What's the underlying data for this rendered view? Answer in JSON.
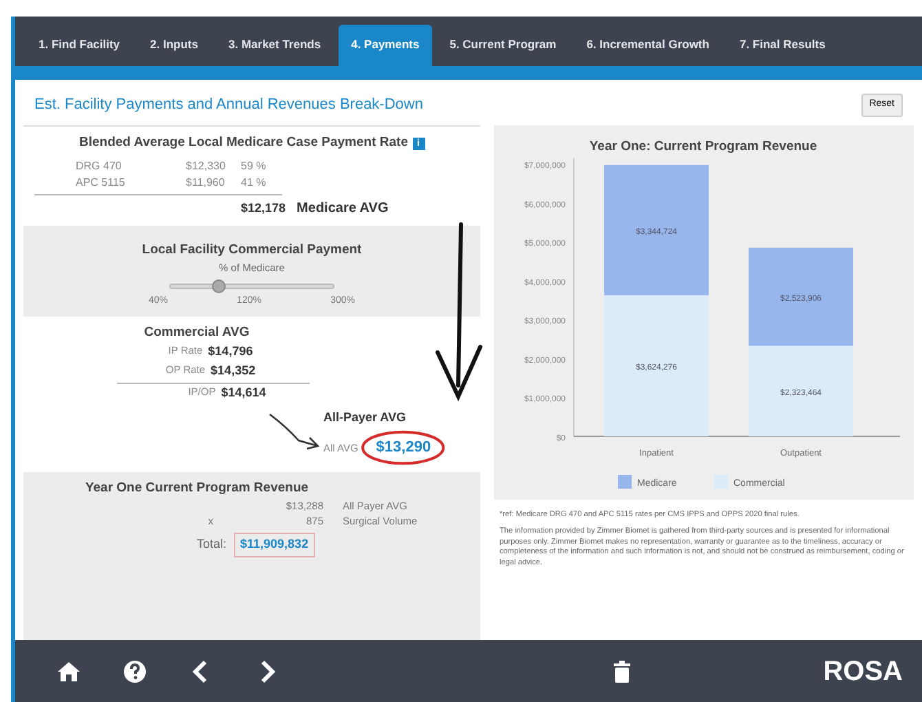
{
  "tabs": [
    {
      "label": "1. Find Facility",
      "selected": false
    },
    {
      "label": "2. Inputs",
      "selected": false
    },
    {
      "label": "3. Market Trends",
      "selected": false
    },
    {
      "label": "4. Payments",
      "selected": true
    },
    {
      "label": "5. Current Program",
      "selected": false
    },
    {
      "label": "6. Incremental Growth",
      "selected": false
    },
    {
      "label": "7. Final Results",
      "selected": false
    }
  ],
  "page_title": "Est. Facility Payments and Annual Revenues Break-Down",
  "reset_button": "Reset",
  "medicare": {
    "title": "Blended Average Local Medicare Case Payment Rate",
    "info_icon": "i",
    "rows": [
      {
        "code": "DRG 470",
        "amount": "$12,330",
        "share": "59 %"
      },
      {
        "code": "APC 5115",
        "amount": "$11,960",
        "share": "41 %"
      }
    ],
    "average": "$12,178",
    "average_label": "Medicare AVG"
  },
  "commercial_payment": {
    "title": "Local Facility Commercial Payment",
    "subtitle": "% of Medicare",
    "level": 0.3,
    "ticks": [
      "40%",
      "120%",
      "300%"
    ]
  },
  "commercial_avg": {
    "title": "Commercial AVG",
    "rows": [
      {
        "label": "IP Rate",
        "value": "$14,796"
      },
      {
        "label": "OP Rate",
        "value": "$14,352"
      },
      {
        "label": "IP/OP",
        "value": "$14,614"
      }
    ]
  },
  "all_payer": {
    "title": "All-Payer AVG",
    "label": "All AVG",
    "value": "$13,290"
  },
  "revenue": {
    "title": "Year One Current Program Revenue",
    "rows": [
      {
        "operator": "",
        "value": "$13,288",
        "label": "All Payer AVG"
      },
      {
        "operator": "x",
        "value": "875",
        "label": "Surgical Volume"
      }
    ],
    "total_label": "Total:",
    "total": "$11,909,832"
  },
  "chart": {
    "chart_data": {
      "type": "bar",
      "title": "Year One: Current Program Revenue",
      "categories": [
        "Inpatient",
        "Outpatient"
      ],
      "stacked": true,
      "value_labels": [
        [
          "$3,624,276",
          "$2,323,464"
        ],
        [
          "$3,344,724",
          "$2,523,906"
        ]
      ],
      "ylim": [
        0,
        7000000
      ],
      "yticks": [
        {
          "value": 0,
          "label": "$0"
        },
        {
          "value": 1000000,
          "label": "$1,000,000"
        },
        {
          "value": 2000000,
          "label": "$2,000,000"
        },
        {
          "value": 3000000,
          "label": "$3,000,000"
        },
        {
          "value": 4000000,
          "label": "$4,000,000"
        },
        {
          "value": 5000000,
          "label": "$5,000,000"
        },
        {
          "value": 6000000,
          "label": "$6,000,000"
        },
        {
          "value": 7000000,
          "label": "$7,000,000"
        }
      ],
      "legend": "bottom",
      "series": [
        {
          "name": "Commercial",
          "color": "#dcebfa",
          "values": [
            3624276,
            2323464
          ]
        },
        {
          "name": "Medicare",
          "color": "#97b7ec",
          "values": [
            3344724,
            2523906
          ]
        }
      ]
    }
  },
  "notes": [
    "*ref: Medicare DRG 470 and APC 5115 rates per CMS IPPS and OPPS 2020 final rules.",
    "The information provided by Zimmer Biomet is gathered from third-party sources and is presented for informational purposes only. Zimmer Biomet makes no representation, warranty or guarantee as to the timeliness, accuracy or completeness of the information and such information is not, and should not be construed as reimbursement, coding or legal advice."
  ],
  "footer": {
    "brand": "ROSA"
  }
}
